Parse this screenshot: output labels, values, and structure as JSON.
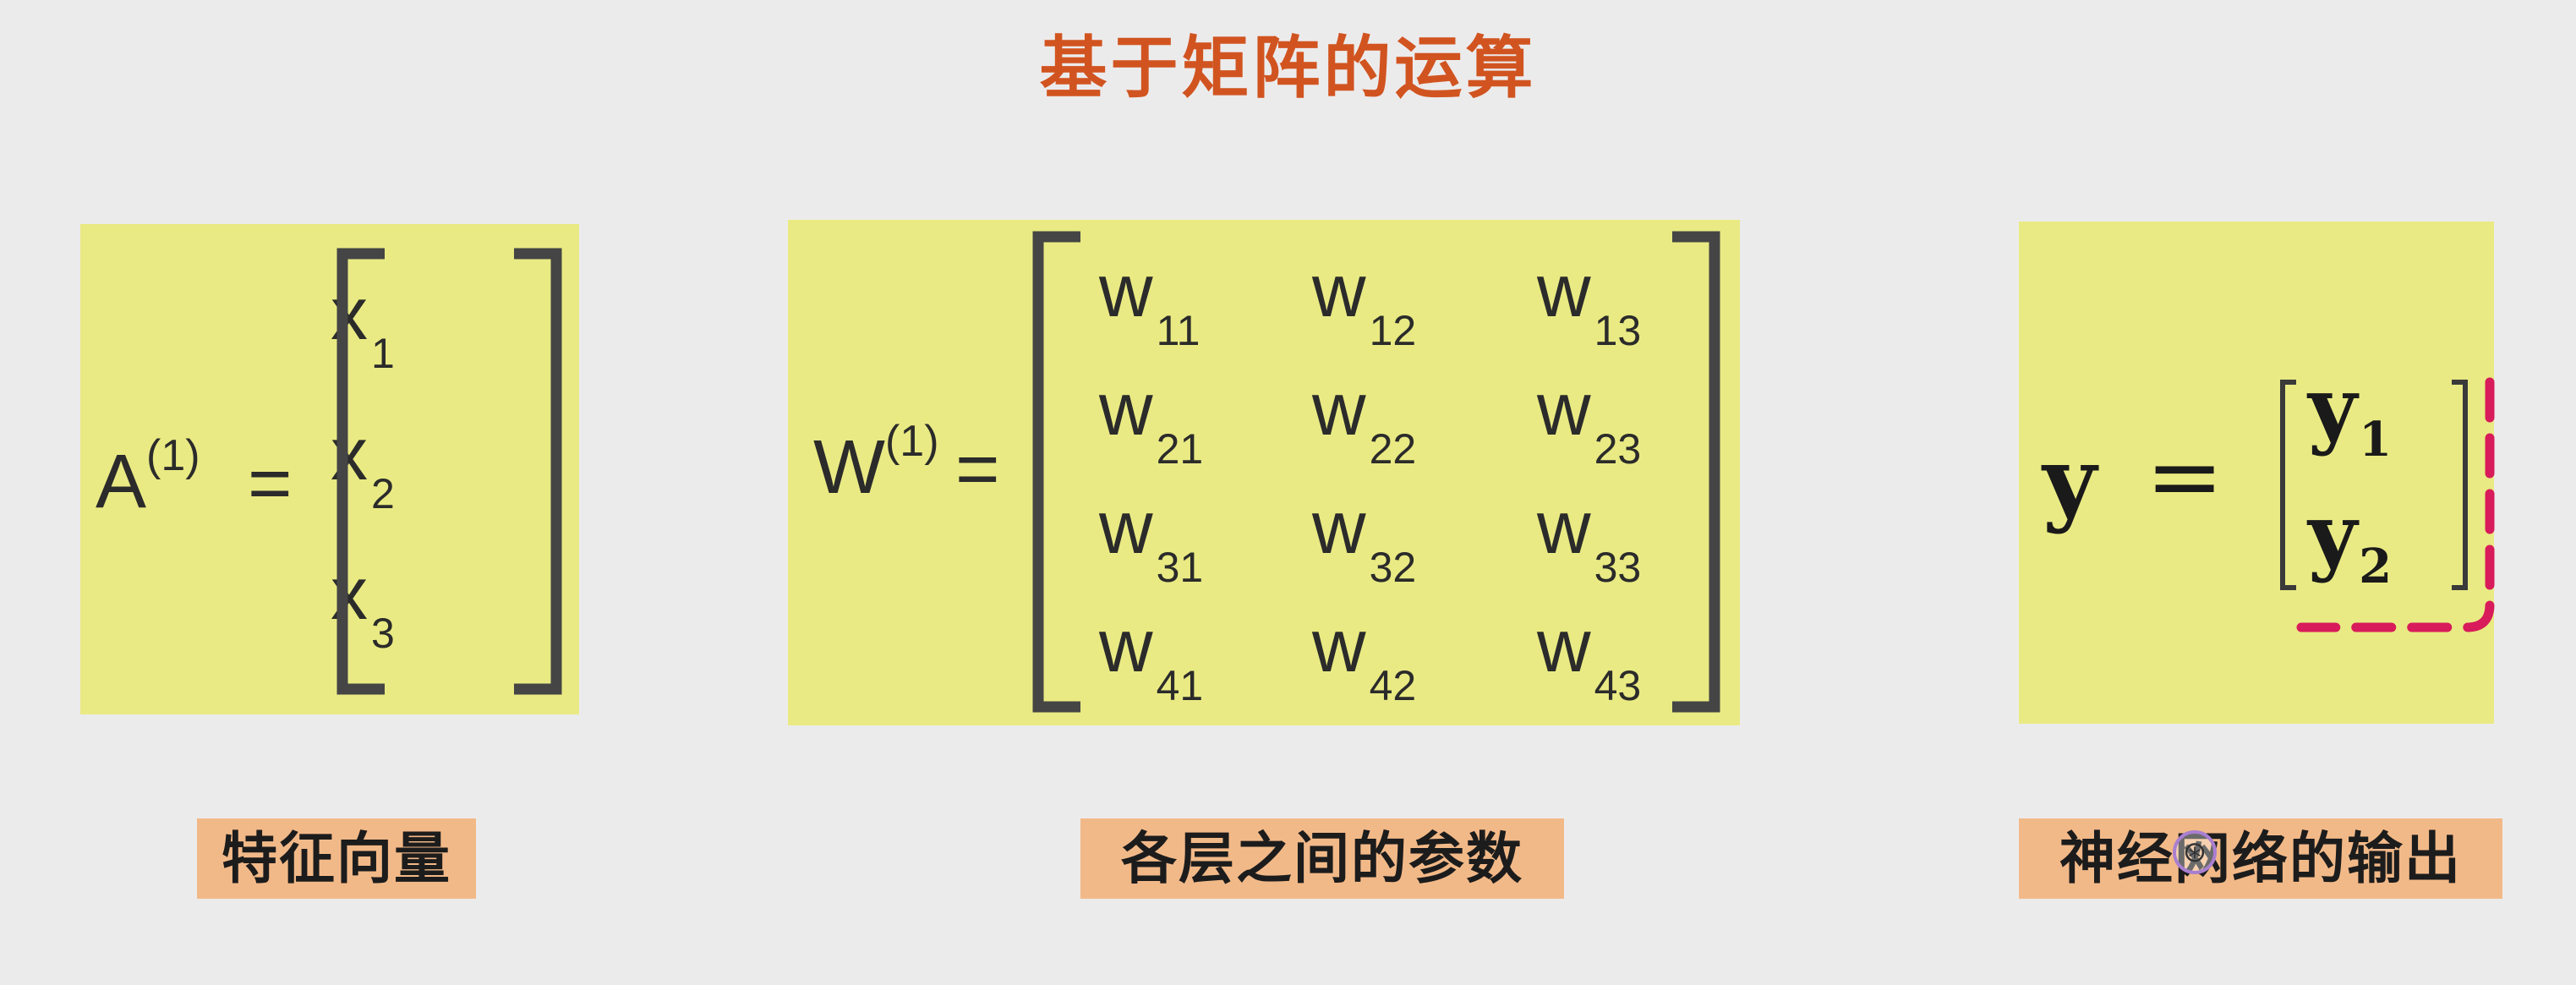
{
  "title": "基于矩阵的运算",
  "feature_vector": {
    "lhs": "A",
    "superscript": "(1)",
    "equals": "=",
    "entries": [
      {
        "base": "x",
        "sub": "1"
      },
      {
        "base": "x",
        "sub": "2"
      },
      {
        "base": "x",
        "sub": "3"
      }
    ],
    "label": "特征向量"
  },
  "weights": {
    "lhs": "W",
    "superscript": "(1)",
    "equals": "=",
    "rows": [
      [
        {
          "base": "w",
          "sub": "11"
        },
        {
          "base": "w",
          "sub": "12"
        },
        {
          "base": "w",
          "sub": "13"
        }
      ],
      [
        {
          "base": "w",
          "sub": "21"
        },
        {
          "base": "w",
          "sub": "22"
        },
        {
          "base": "w",
          "sub": "23"
        }
      ],
      [
        {
          "base": "w",
          "sub": "31"
        },
        {
          "base": "w",
          "sub": "32"
        },
        {
          "base": "w",
          "sub": "33"
        }
      ],
      [
        {
          "base": "w",
          "sub": "41"
        },
        {
          "base": "w",
          "sub": "42"
        },
        {
          "base": "w",
          "sub": "43"
        }
      ]
    ],
    "label": "各层之间的参数"
  },
  "output": {
    "lhs": "y",
    "equals": "=",
    "entries": [
      {
        "base": "y",
        "sub": "1"
      },
      {
        "base": "y",
        "sub": "2"
      }
    ],
    "label": "神经网络的输出"
  },
  "colors": {
    "background": "#ecebec",
    "title": "#d15420",
    "panel": "#e9ea83",
    "label_bg": "#f2b988",
    "annotation": "#d81b5a"
  }
}
